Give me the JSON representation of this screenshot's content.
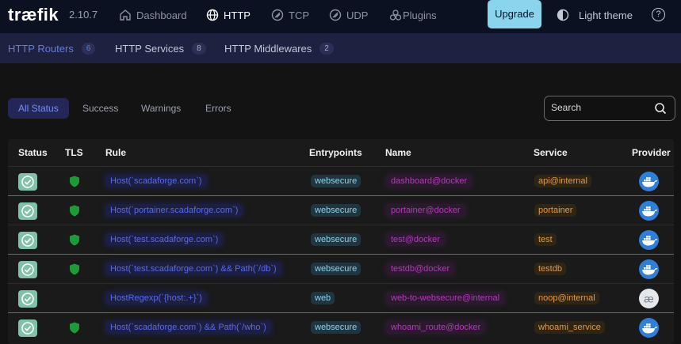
{
  "app": {
    "logo": "træfik",
    "version": "2.10.7"
  },
  "nav": {
    "links": [
      {
        "id": "dashboard",
        "label": "Dashboard",
        "icon": "home-icon"
      },
      {
        "id": "http",
        "label": "HTTP",
        "icon": "globe-icon"
      },
      {
        "id": "tcp",
        "label": "TCP",
        "icon": "tcp-icon"
      },
      {
        "id": "udp",
        "label": "UDP",
        "icon": "udp-icon"
      },
      {
        "id": "plugins",
        "label": "Plugins",
        "icon": "plugins-icon"
      }
    ],
    "active": "HTTP",
    "upgrade_label": "Upgrade",
    "theme_label": "Light theme",
    "help_icon": "question-icon"
  },
  "tabs": [
    {
      "label": "HTTP Routers",
      "count": "6"
    },
    {
      "label": "HTTP Services",
      "count": "8"
    },
    {
      "label": "HTTP Middlewares",
      "count": "2"
    }
  ],
  "filters": {
    "options": [
      "All Status",
      "Success",
      "Warnings",
      "Errors"
    ],
    "selected": "All Status",
    "search_placeholder": "Search"
  },
  "table": {
    "columns": [
      "Status",
      "TLS",
      "Rule",
      "Entrypoints",
      "Name",
      "Service",
      "Provider"
    ],
    "rows": [
      {
        "status": "success",
        "tls": true,
        "rule": "Host(`scadaforge.com`)",
        "entrypoint": "websecure",
        "name": "dashboard@docker",
        "service": "api@internal",
        "provider": "docker"
      },
      {
        "status": "success",
        "tls": true,
        "rule": "Host(`portainer.scadaforge.com`)",
        "entrypoint": "websecure",
        "name": "portainer@docker",
        "service": "portainer",
        "provider": "docker"
      },
      {
        "status": "success",
        "tls": true,
        "rule": "Host(`test.scadaforge.com`)",
        "entrypoint": "websecure",
        "name": "test@docker",
        "service": "test",
        "provider": "docker"
      },
      {
        "status": "success",
        "tls": true,
        "rule": "Host(`test.scadaforge.com`) && Path(`/db`)",
        "entrypoint": "websecure",
        "name": "testdb@docker",
        "service": "testdb",
        "provider": "docker"
      },
      {
        "status": "success",
        "tls": false,
        "rule": "HostRegexp(`{host:.+}`)",
        "entrypoint": "web",
        "name": "web-to-websecure@internal",
        "service": "noop@internal",
        "provider": "internal"
      },
      {
        "status": "success",
        "tls": true,
        "rule": "Host(`scadaforge.com`) && Path(`/who`)",
        "entrypoint": "websecure",
        "name": "whoami_route@docker",
        "service": "whoami_service",
        "provider": "docker"
      }
    ]
  },
  "colors": {
    "topbar": "#0c1122",
    "subbar": "#1e2140",
    "accent": "#5f7ce6",
    "success": "#7fc2a9",
    "tls": "#1f9a3a",
    "rule": "#5a6aeb",
    "entrypoint": "#8ad4ee",
    "name": "#b23bb8",
    "service": "#e39a46",
    "provider_docker": "#2f7ed8"
  }
}
